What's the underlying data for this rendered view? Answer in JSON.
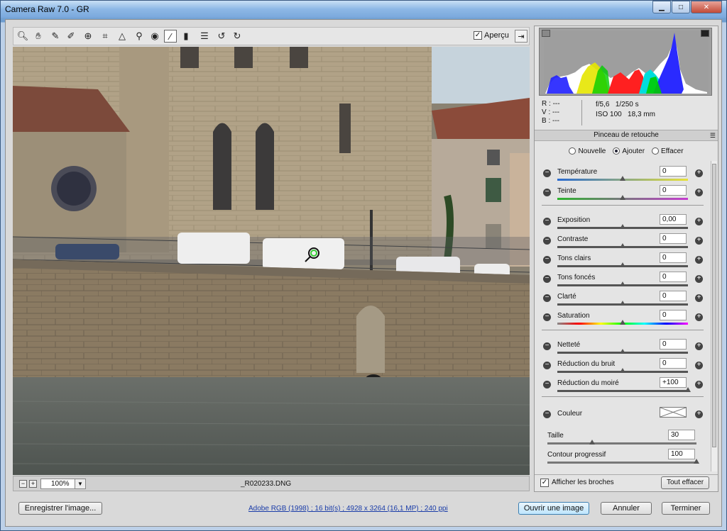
{
  "window": {
    "title": "Camera Raw 7.0  -  GR"
  },
  "toolbar": {
    "tools": [
      "zoom-icon",
      "hand-icon",
      "white-balance-icon",
      "color-sampler-icon",
      "targeted-adjust-icon",
      "crop-icon",
      "straighten-icon",
      "spot-removal-icon",
      "red-eye-icon",
      "adjustment-brush-icon",
      "graduated-filter-icon",
      "preferences-icon",
      "rotate-left-icon",
      "rotate-right-icon"
    ],
    "preview_label": "Aperçu",
    "preview_checked": true
  },
  "status": {
    "zoom": "100%",
    "filename": "_R020233.DNG"
  },
  "readout": {
    "r_label": "R :",
    "r_val": "---",
    "v_label": "V :",
    "v_val": "---",
    "b_label": "B :",
    "b_val": "---",
    "aperture": "f/5,6",
    "shutter": "1/250 s",
    "iso": "ISO 100",
    "focal": "18,3 mm"
  },
  "panel": {
    "title": "Pinceau de retouche",
    "modes": [
      "Nouvelle",
      "Ajouter",
      "Effacer"
    ],
    "selected_mode": "Ajouter",
    "sliders": [
      {
        "label": "Température",
        "value": "0",
        "pos": 0.5
      },
      {
        "label": "Teinte",
        "value": "0",
        "pos": 0.5
      },
      {
        "label": "Exposition",
        "value": "0,00",
        "pos": 0.5
      },
      {
        "label": "Contraste",
        "value": "0",
        "pos": 0.5
      },
      {
        "label": "Tons clairs",
        "value": "0",
        "pos": 0.5
      },
      {
        "label": "Tons foncés",
        "value": "0",
        "pos": 0.5
      },
      {
        "label": "Clarté",
        "value": "0",
        "pos": 0.5
      },
      {
        "label": "Saturation",
        "value": "0",
        "pos": 0.5
      },
      {
        "label": "Netteté",
        "value": "0",
        "pos": 0.5
      },
      {
        "label": "Réduction du bruit",
        "value": "0",
        "pos": 0.5
      },
      {
        "label": "Réduction du moiré",
        "value": "+100",
        "pos": 1.0
      }
    ],
    "color_label": "Couleur",
    "size_label": "Taille",
    "size_value": "30",
    "feather_label": "Contour progressif",
    "feather_value": "100",
    "show_pins_label": "Afficher les broches",
    "show_pins_checked": true,
    "clear_all": "Tout effacer"
  },
  "footer": {
    "save": "Enregistrer l'image...",
    "workflow_link": "Adobe RGB (1998) ; 16 bit(s) ; 4928 x 3264 (16,1 MP) ; 240 ppi",
    "open": "Ouvrir une image",
    "cancel": "Annuler",
    "done": "Terminer"
  }
}
